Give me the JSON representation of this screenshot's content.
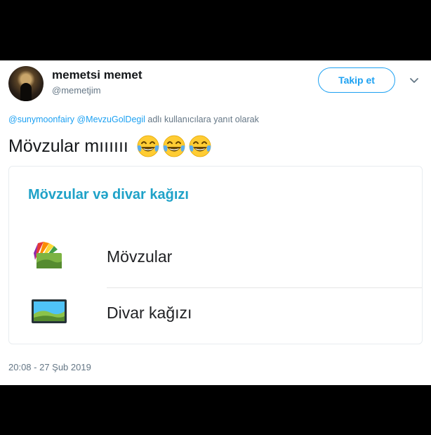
{
  "author": {
    "display_name": "memetsi memet",
    "handle": "@memetjim"
  },
  "follow_button": {
    "label": "Takip et"
  },
  "reply": {
    "mentions": [
      "@sunymoonfairy",
      "@MevzuGolDegil"
    ],
    "suffix": "adlı kullanıcılara yanıt olarak"
  },
  "tweet": {
    "text": "Mövzular mıııııı",
    "emojis": [
      "face-with-tears-of-joy-icon",
      "face-with-tears-of-joy-icon",
      "face-with-tears-of-joy-icon"
    ]
  },
  "card": {
    "title": "Mövzular və divar kağızı",
    "items": [
      {
        "label": "Mövzular",
        "icon": "themes-palette-icon"
      },
      {
        "label": "Divar kağızı",
        "icon": "wallpaper-picture-icon"
      }
    ]
  },
  "timestamp": "20:08 - 27 Şub 2019",
  "colors": {
    "accent": "#1da1f2",
    "card_title": "#1fa2c8",
    "secondary_text": "#657786"
  }
}
